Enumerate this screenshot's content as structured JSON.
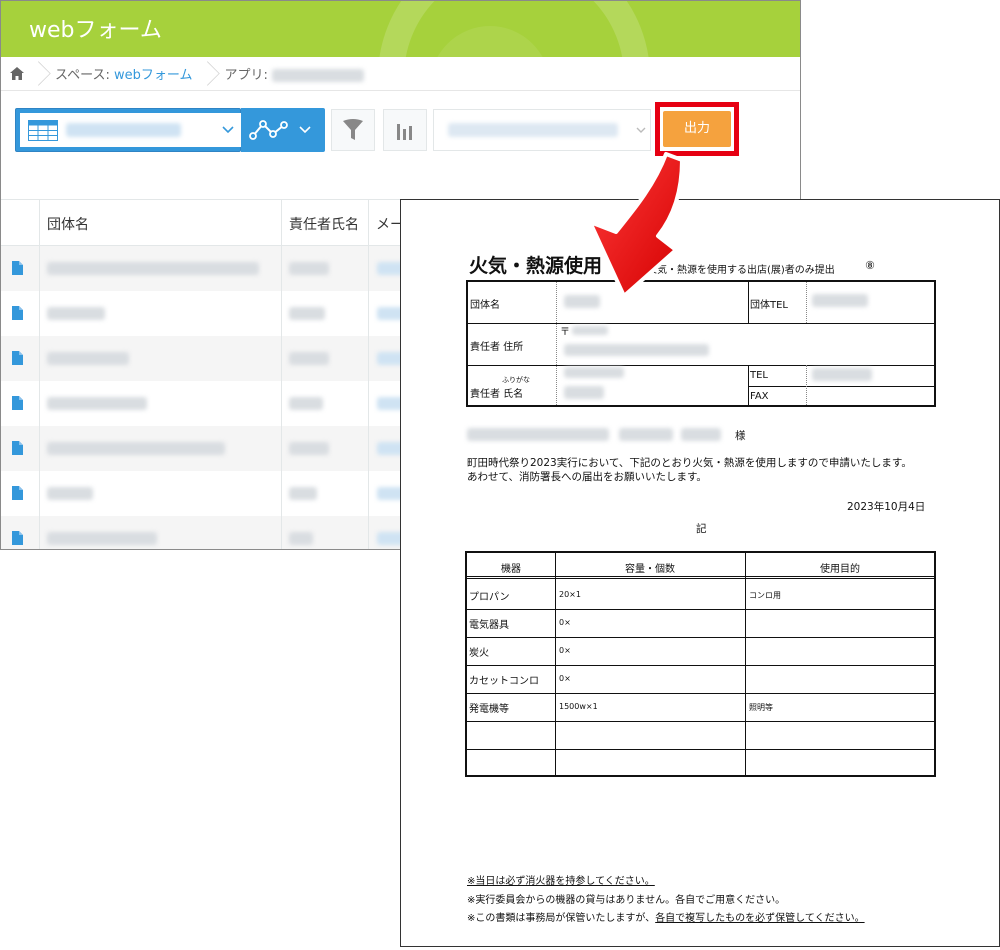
{
  "app": {
    "title": "webフォーム",
    "breadcrumb": {
      "space_label": "スペース: ",
      "space_link": "webフォーム",
      "app_label": "アプリ: "
    },
    "toolbar": {
      "output_label": "出力"
    },
    "list": {
      "columns": [
        "団体名",
        "責任者氏名",
        "メー"
      ]
    }
  },
  "form": {
    "title": "火気・熱源使用",
    "subtitle": "火気・熱源を使用する出店(展)者のみ提出",
    "number": "⑧",
    "labels": {
      "group_name": "団体名",
      "group_tel": "団体TEL",
      "postal_mark": "〒",
      "owner_address": "責任者 住所",
      "furigana": "ふりがな",
      "owner_name": "責任者 氏名",
      "tel": "TEL",
      "fax": "FAX"
    },
    "honorific": "様",
    "body_line1": "町田時代祭り2023実行において、下記のとおり火気・熱源を使用しますので申請いたします。",
    "body_line2": "あわせて、消防署長への届出をお願いいたします。",
    "date": "2023年10月4日",
    "ki": "記",
    "equipment": {
      "headers": [
        "機器",
        "容量・個数",
        "使用目的"
      ],
      "rows": [
        {
          "name": "プロパン",
          "qty": "20×1",
          "purpose": "コンロ用"
        },
        {
          "name": "電気器具",
          "qty": "0×",
          "purpose": ""
        },
        {
          "name": "炭火",
          "qty": "0×",
          "purpose": ""
        },
        {
          "name": "カセットコンロ",
          "qty": "0×",
          "purpose": ""
        },
        {
          "name": "発電機等",
          "qty": "1500w×1",
          "purpose": "照明等"
        },
        {
          "name": "",
          "qty": "",
          "purpose": ""
        },
        {
          "name": "",
          "qty": "",
          "purpose": ""
        }
      ]
    },
    "notes": {
      "note1": "※当日は必ず消火器を持参してください。",
      "note2": "※実行委員会からの機器の貸与はありません。各自でご用意ください。",
      "note3_a": "※この書類は事務局が保管いたしますが、",
      "note3_b": "各自で複写したものを必ず保管してください。"
    }
  },
  "colors": {
    "header_green": "#a6d13c",
    "accent_blue": "#3498db",
    "output_orange": "#f5a23e",
    "highlight_red": "#e60012"
  }
}
